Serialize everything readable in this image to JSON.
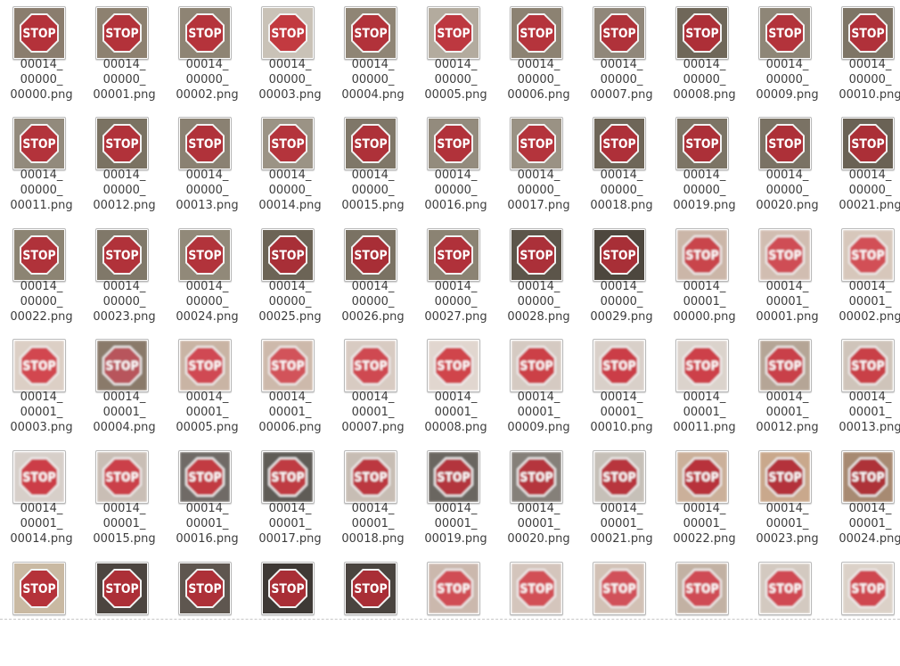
{
  "window": {
    "title": ""
  },
  "files": [
    {
      "name": [
        "00014_",
        "00000_",
        "00000.png"
      ],
      "bg": "#8a7d6e",
      "sign": "#b4323a",
      "variant": "sharp"
    },
    {
      "name": [
        "00014_",
        "00000_",
        "00001.png"
      ],
      "bg": "#8d8170",
      "sign": "#b3323a",
      "variant": "sharp"
    },
    {
      "name": [
        "00014_",
        "00000_",
        "00002.png"
      ],
      "bg": "#8e8474",
      "sign": "#b5333b",
      "variant": "sharp"
    },
    {
      "name": [
        "00014_",
        "00000_",
        "00003.png"
      ],
      "bg": "#c9c2b7",
      "sign": "#c23a40",
      "variant": "sharp"
    },
    {
      "name": [
        "00014_",
        "00000_",
        "00004.png"
      ],
      "bg": "#8f8575",
      "sign": "#b2323a",
      "variant": "sharp"
    },
    {
      "name": [
        "00014_",
        "00000_",
        "00005.png"
      ],
      "bg": "#b3ab9e",
      "sign": "#bd3840",
      "variant": "sharp"
    },
    {
      "name": [
        "00014_",
        "00000_",
        "00006.png"
      ],
      "bg": "#8c8272",
      "sign": "#b5343c",
      "variant": "sharp"
    },
    {
      "name": [
        "00014_",
        "00000_",
        "00007.png"
      ],
      "bg": "#90877a",
      "sign": "#b0323a",
      "variant": "sharp"
    },
    {
      "name": [
        "00014_",
        "00000_",
        "00008.png"
      ],
      "bg": "#6f6759",
      "sign": "#ad2f37",
      "variant": "sharp"
    },
    {
      "name": [
        "00014_",
        "00000_",
        "00009.png"
      ],
      "bg": "#8e8677",
      "sign": "#b3333b",
      "variant": "sharp"
    },
    {
      "name": [
        "00014_",
        "00000_",
        "00010.png"
      ],
      "bg": "#7e7566",
      "sign": "#b0313a",
      "variant": "sharp"
    },
    {
      "name": [
        "00014_",
        "00000_",
        "00011.png"
      ],
      "bg": "#928a7c",
      "sign": "#b3333b",
      "variant": "sharp"
    },
    {
      "name": [
        "00014_",
        "00000_",
        "00012.png"
      ],
      "bg": "#7a7262",
      "sign": "#b1323a",
      "variant": "sharp"
    },
    {
      "name": [
        "00014_",
        "00000_",
        "00013.png"
      ],
      "bg": "#8a8172",
      "sign": "#b0323a",
      "variant": "sharp"
    },
    {
      "name": [
        "00014_",
        "00000_",
        "00014.png"
      ],
      "bg": "#9b9385",
      "sign": "#b4343c",
      "variant": "sharp"
    },
    {
      "name": [
        "00014_",
        "00000_",
        "00015.png"
      ],
      "bg": "#7f7768",
      "sign": "#ae3139",
      "variant": "sharp"
    },
    {
      "name": [
        "00014_",
        "00000_",
        "00016.png"
      ],
      "bg": "#938b7d",
      "sign": "#b1323a",
      "variant": "sharp"
    },
    {
      "name": [
        "00014_",
        "00000_",
        "00017.png"
      ],
      "bg": "#9a9284",
      "sign": "#b4343c",
      "variant": "sharp"
    },
    {
      "name": [
        "00014_",
        "00000_",
        "00018.png"
      ],
      "bg": "#6e6658",
      "sign": "#ae3039",
      "variant": "sharp"
    },
    {
      "name": [
        "00014_",
        "00000_",
        "00019.png"
      ],
      "bg": "#7c7465",
      "sign": "#ac3038",
      "variant": "sharp"
    },
    {
      "name": [
        "00014_",
        "00000_",
        "00020.png"
      ],
      "bg": "#7a7264",
      "sign": "#ad3038",
      "variant": "sharp"
    },
    {
      "name": [
        "00014_",
        "00000_",
        "00021.png"
      ],
      "bg": "#6a6255",
      "sign": "#ab2f37",
      "variant": "sharp"
    },
    {
      "name": [
        "00014_",
        "00000_",
        "00022.png"
      ],
      "bg": "#8c8473",
      "sign": "#b0323a",
      "variant": "sharp"
    },
    {
      "name": [
        "00014_",
        "00000_",
        "00023.png"
      ],
      "bg": "#807869",
      "sign": "#b1323a",
      "variant": "sharp"
    },
    {
      "name": [
        "00014_",
        "00000_",
        "00024.png"
      ],
      "bg": "#918979",
      "sign": "#b2333b",
      "variant": "sharp"
    },
    {
      "name": [
        "00014_",
        "00000_",
        "00025.png"
      ],
      "bg": "#6c6456",
      "sign": "#a82f37",
      "variant": "sharp"
    },
    {
      "name": [
        "00014_",
        "00000_",
        "00026.png"
      ],
      "bg": "#7a7263",
      "sign": "#a82e36",
      "variant": "sharp"
    },
    {
      "name": [
        "00014_",
        "00000_",
        "00027.png"
      ],
      "bg": "#8b8373",
      "sign": "#b0313a",
      "variant": "sharp"
    },
    {
      "name": [
        "00014_",
        "00000_",
        "00028.png"
      ],
      "bg": "#5c554a",
      "sign": "#ab3039",
      "variant": "sharp"
    },
    {
      "name": [
        "00014_",
        "00000_",
        "00029.png"
      ],
      "bg": "#4d473e",
      "sign": "#a82f37",
      "variant": "sharp"
    },
    {
      "name": [
        "00014_",
        "00001_",
        "00000.png"
      ],
      "bg": "#cbb6a8",
      "sign": "#c9454c",
      "variant": "blurry"
    },
    {
      "name": [
        "00014_",
        "00001_",
        "00001.png"
      ],
      "bg": "#d1bdb1",
      "sign": "#cf4d54",
      "variant": "blurry"
    },
    {
      "name": [
        "00014_",
        "00001_",
        "00002.png"
      ],
      "bg": "#d7c7bb",
      "sign": "#d24f56",
      "variant": "blurry"
    },
    {
      "name": [
        "00014_",
        "00001_",
        "00003.png"
      ],
      "bg": "#dccfc5",
      "sign": "#d2474f",
      "variant": "blurry"
    },
    {
      "name": [
        "00014_",
        "00001_",
        "00004.png"
      ],
      "bg": "#8a7a6a",
      "sign": "#b8545b",
      "variant": "blurry"
    },
    {
      "name": [
        "00014_",
        "00001_",
        "00005.png"
      ],
      "bg": "#c9b4a4",
      "sign": "#d04a52",
      "variant": "blurry"
    },
    {
      "name": [
        "00014_",
        "00001_",
        "00006.png"
      ],
      "bg": "#cdb9ab",
      "sign": "#d2525a",
      "variant": "blurry"
    },
    {
      "name": [
        "00014_",
        "00001_",
        "00007.png"
      ],
      "bg": "#d8cbc2",
      "sign": "#cf4951",
      "variant": "blurry"
    },
    {
      "name": [
        "00014_",
        "00001_",
        "00008.png"
      ],
      "bg": "#e1d6cf",
      "sign": "#d0444c",
      "variant": "blurry"
    },
    {
      "name": [
        "00014_",
        "00001_",
        "00009.png"
      ],
      "bg": "#d5cac2",
      "sign": "#cc3f47",
      "variant": "blurry"
    },
    {
      "name": [
        "00014_",
        "00001_",
        "00010.png"
      ],
      "bg": "#d9d0c9",
      "sign": "#cb3e46",
      "variant": "blurry"
    },
    {
      "name": [
        "00014_",
        "00001_",
        "00011.png"
      ],
      "bg": "#dbd3cc",
      "sign": "#cd4048",
      "variant": "blurry"
    },
    {
      "name": [
        "00014_",
        "00001_",
        "00012.png"
      ],
      "bg": "#b5a596",
      "sign": "#c9404a",
      "variant": "blurry"
    },
    {
      "name": [
        "00014_",
        "00001_",
        "00013.png"
      ],
      "bg": "#cfc4ba",
      "sign": "#c93f47",
      "variant": "blurry"
    },
    {
      "name": [
        "00014_",
        "00001_",
        "00014.png"
      ],
      "bg": "#d7cfc9",
      "sign": "#cc3e46",
      "variant": "blurry"
    },
    {
      "name": [
        "00014_",
        "00001_",
        "00015.png"
      ],
      "bg": "#c9beb5",
      "sign": "#cb4048",
      "variant": "blurry"
    },
    {
      "name": [
        "00014_",
        "00001_",
        "00016.png"
      ],
      "bg": "#6f6b66",
      "sign": "#c23a42",
      "variant": "blurry"
    },
    {
      "name": [
        "00014_",
        "00001_",
        "00017.png"
      ],
      "bg": "#5f5b57",
      "sign": "#bf3a42",
      "variant": "blurry"
    },
    {
      "name": [
        "00014_",
        "00001_",
        "00018.png"
      ],
      "bg": "#c7bdb4",
      "sign": "#bc3740",
      "variant": "blurry"
    },
    {
      "name": [
        "00014_",
        "00001_",
        "00019.png"
      ],
      "bg": "#6a6661",
      "sign": "#b3343c",
      "variant": "blurry"
    },
    {
      "name": [
        "00014_",
        "00001_",
        "00020.png"
      ],
      "bg": "#858079",
      "sign": "#b5353d",
      "variant": "blurry"
    },
    {
      "name": [
        "00014_",
        "00001_",
        "00021.png"
      ],
      "bg": "#c6c0b8",
      "sign": "#b8353e",
      "variant": "blurry"
    },
    {
      "name": [
        "00014_",
        "00001_",
        "00022.png"
      ],
      "bg": "#cbb09a",
      "sign": "#b8333b",
      "variant": "blurry"
    },
    {
      "name": [
        "00014_",
        "00001_",
        "00023.png"
      ],
      "bg": "#c9a88c",
      "sign": "#b4323a",
      "variant": "blurry"
    },
    {
      "name": [
        "00014_",
        "00001_",
        "00024.png"
      ],
      "bg": "#a78a72",
      "sign": "#ae3038",
      "variant": "blurry"
    },
    {
      "name": [
        "",
        "",
        ""
      ],
      "bg": "#c9b9a2",
      "sign": "#b5323a",
      "variant": "sharp"
    },
    {
      "name": [
        "",
        "",
        ""
      ],
      "bg": "#4c4540",
      "sign": "#ac2f37",
      "variant": "sharp"
    },
    {
      "name": [
        "",
        "",
        ""
      ],
      "bg": "#5e564f",
      "sign": "#ad3038",
      "variant": "sharp"
    },
    {
      "name": [
        "",
        "",
        ""
      ],
      "bg": "#3e3935",
      "sign": "#a92e36",
      "variant": "sharp"
    },
    {
      "name": [
        "",
        "",
        ""
      ],
      "bg": "#4a443f",
      "sign": "#a92e36",
      "variant": "sharp"
    },
    {
      "name": [
        "",
        "",
        ""
      ],
      "bg": "#cbb8ad",
      "sign": "#d04d55",
      "variant": "blurry"
    },
    {
      "name": [
        "",
        "",
        ""
      ],
      "bg": "#d4c5bc",
      "sign": "#d24f57",
      "variant": "blurry"
    },
    {
      "name": [
        "",
        "",
        ""
      ],
      "bg": "#d2c1b5",
      "sign": "#d1515a",
      "variant": "blurry"
    },
    {
      "name": [
        "",
        "",
        ""
      ],
      "bg": "#c2b1a3",
      "sign": "#cf4c55",
      "variant": "blurry"
    },
    {
      "name": [
        "",
        "",
        ""
      ],
      "bg": "#d3c9c0",
      "sign": "#d04a52",
      "variant": "blurry"
    },
    {
      "name": [
        "",
        "",
        ""
      ],
      "bg": "#dbd1c8",
      "sign": "#cf4750",
      "variant": "blurry"
    }
  ],
  "sign_text": "STOP"
}
